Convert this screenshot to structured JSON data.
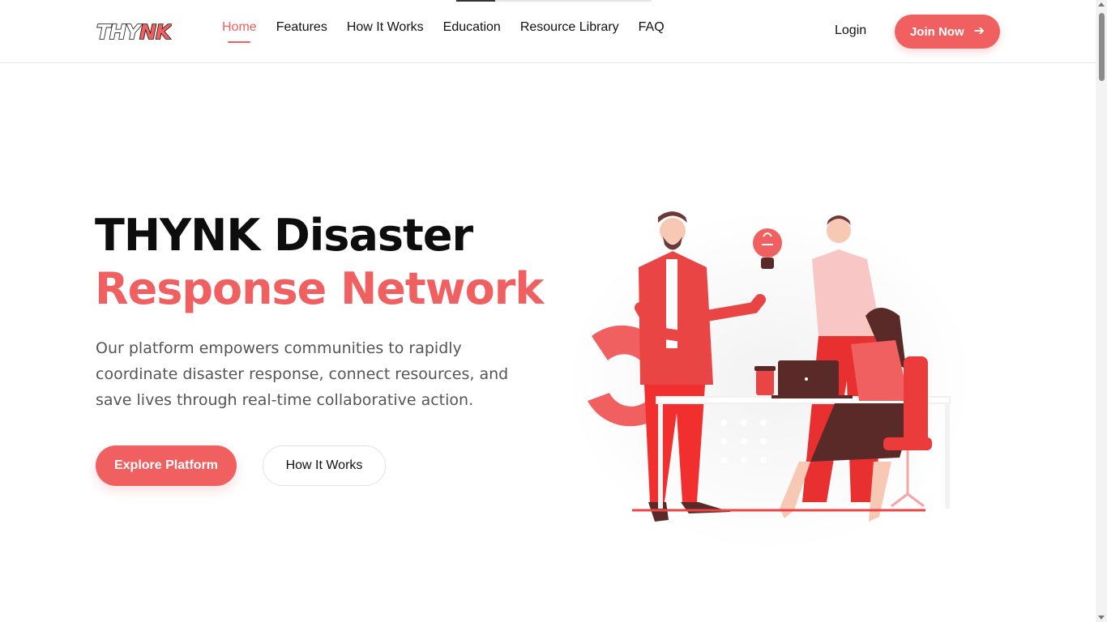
{
  "header": {
    "logo_text": "THYNK",
    "nav": [
      {
        "label": "Home",
        "active": true
      },
      {
        "label": "Features",
        "active": false
      },
      {
        "label": "How It Works",
        "active": false
      },
      {
        "label": "Education",
        "active": false
      },
      {
        "label": "Resource Library",
        "active": false
      },
      {
        "label": "FAQ",
        "active": false
      }
    ],
    "login_label": "Login",
    "join_label": "Join Now",
    "join_icon": "arrow-right-icon"
  },
  "hero": {
    "title_line1": "THYNK Disaster",
    "title_line2": "Response Network",
    "description": "Our platform empowers communities to rapidly coordinate disaster response, connect resources, and save lives through real-time collaborative action.",
    "primary_button": "Explore Platform",
    "secondary_button": "How It Works"
  },
  "colors": {
    "accent": "#f06060",
    "text_dark": "#0d0d0d",
    "text_muted": "#555555"
  }
}
